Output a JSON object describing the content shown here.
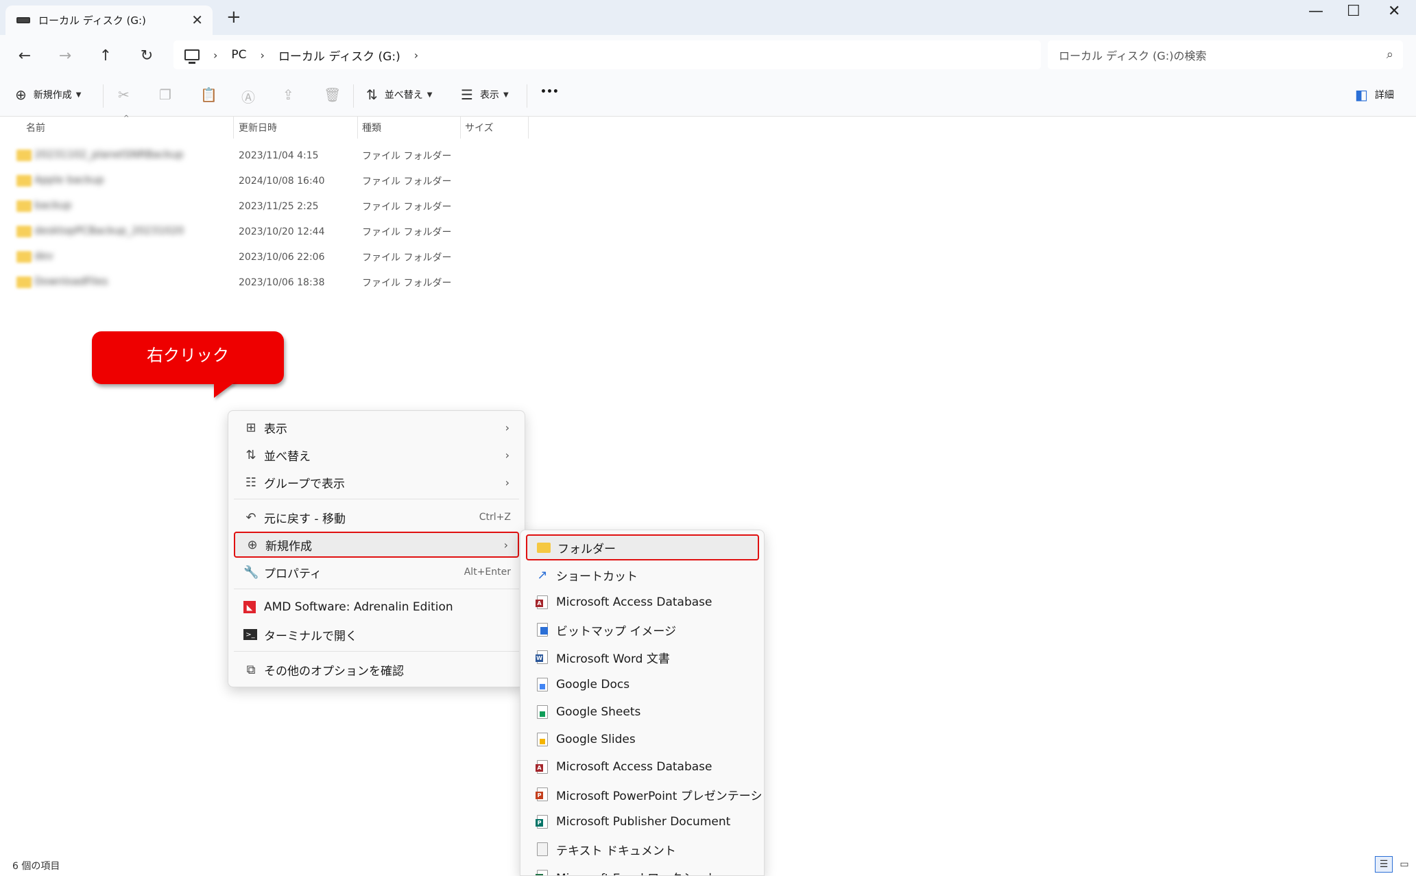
{
  "window": {
    "tab_title": "ローカル ディスク (G:)",
    "new_tab": "+",
    "minimize": "—",
    "maximize": "☐",
    "close": "✕"
  },
  "nav": {
    "back": "←",
    "forward": "→",
    "up": "↑",
    "refresh": "↻",
    "breadcrumb": [
      "PC",
      "ローカル ディスク (G:)"
    ],
    "breadcrumb_sep": "›",
    "search_placeholder": "ローカル ディスク (G:)の検索"
  },
  "toolbar": {
    "new_label": "新規作成",
    "sort_label": "並べ替え",
    "view_label": "表示",
    "more_label": "•••",
    "details_label": "詳細"
  },
  "columns": {
    "name": "名前",
    "modified": "更新日時",
    "type": "種類",
    "size": "サイズ"
  },
  "files": [
    {
      "name": "20231102_planetSNRBackup",
      "modified": "2023/11/04 4:15",
      "type": "ファイル フォルダー"
    },
    {
      "name": "Apple backup",
      "modified": "2024/10/08 16:40",
      "type": "ファイル フォルダー"
    },
    {
      "name": "backup",
      "modified": "2023/11/25 2:25",
      "type": "ファイル フォルダー"
    },
    {
      "name": "desktopPCBackup_20231020",
      "modified": "2023/10/20 12:44",
      "type": "ファイル フォルダー"
    },
    {
      "name": "dev",
      "modified": "2023/10/06 22:06",
      "type": "ファイル フォルダー"
    },
    {
      "name": "DownloadFiles",
      "modified": "2023/10/06 18:38",
      "type": "ファイル フォルダー"
    }
  ],
  "status": {
    "item_count": "6 個の項目"
  },
  "callout": {
    "text": "右クリック"
  },
  "context_menu": {
    "view": "表示",
    "sort": "並べ替え",
    "group": "グループで表示",
    "undo": "元に戻す - 移動",
    "undo_shortcut": "Ctrl+Z",
    "new": "新規作成",
    "properties": "プロパティ",
    "properties_shortcut": "Alt+Enter",
    "amd": "AMD Software: Adrenalin Edition",
    "terminal": "ターミナルで開く",
    "more_options": "その他のオプションを確認"
  },
  "submenu": {
    "items": [
      "フォルダー",
      "ショートカット",
      "Microsoft Access Database",
      "ビットマップ イメージ",
      "Microsoft Word 文書",
      "Google Docs",
      "Google Sheets",
      "Google Slides",
      "Microsoft Access Database",
      "Microsoft PowerPoint プレゼンテーション",
      "Microsoft Publisher Document",
      "テキスト ドキュメント",
      "Microsoft Excel ワークシート"
    ]
  },
  "colors": {
    "highlight_border": "#e01010",
    "callout_bg": "#ee0000",
    "folder": "#f5c842"
  }
}
